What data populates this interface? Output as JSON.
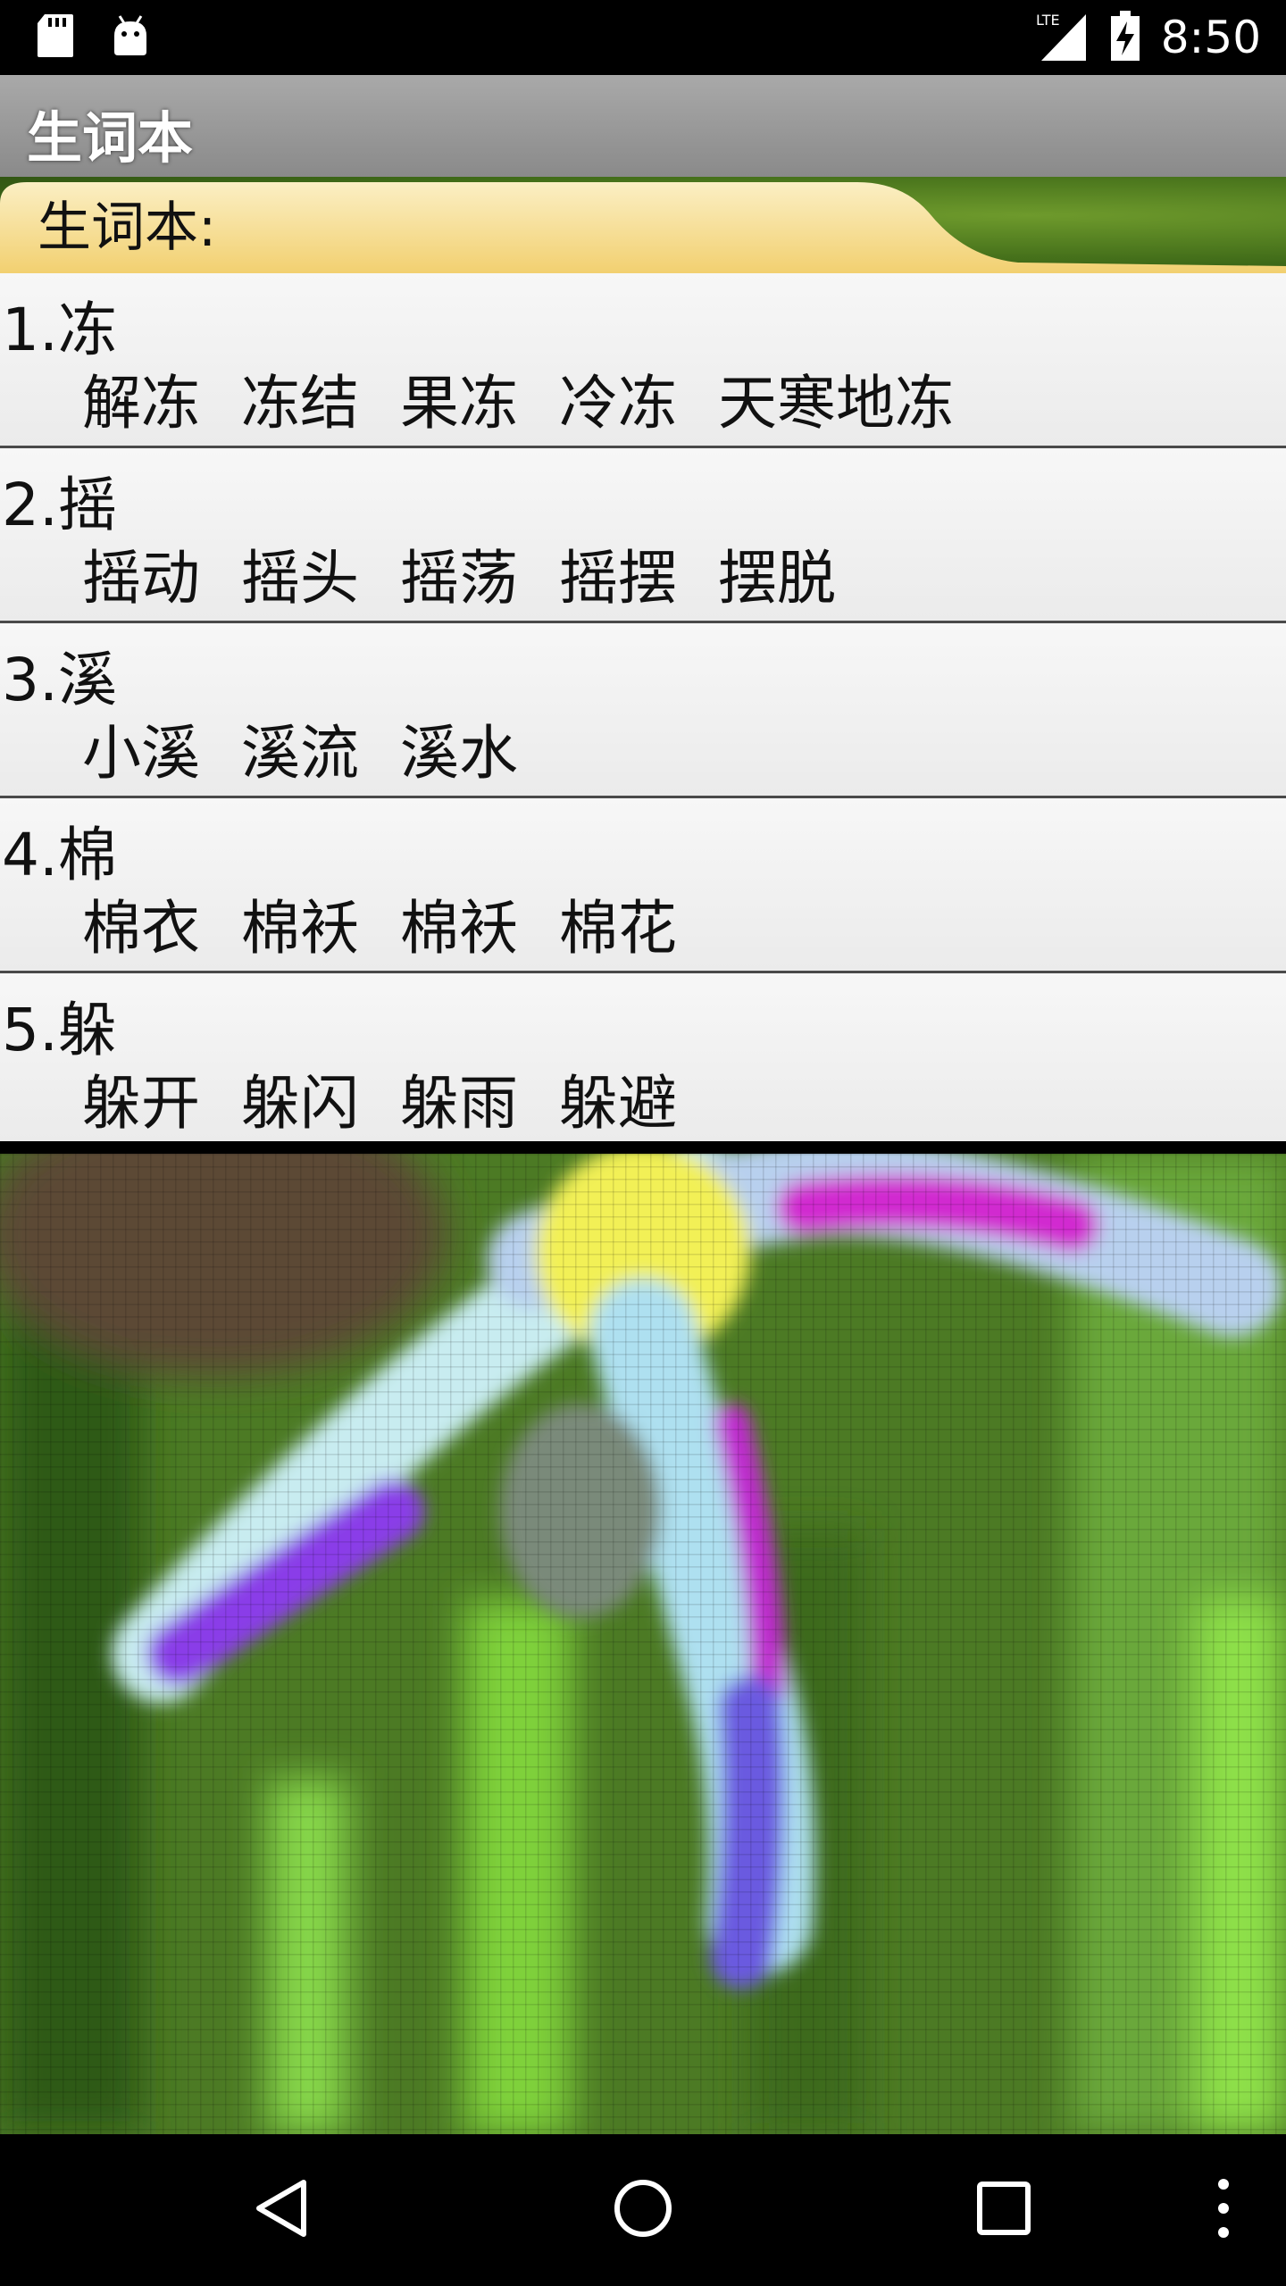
{
  "status_bar": {
    "time": "8:50",
    "network": "LTE",
    "icons": [
      "sd-card-icon",
      "android-icon",
      "signal-icon",
      "battery-charging-icon"
    ]
  },
  "app": {
    "title": "生词本"
  },
  "header": {
    "label": "生词本:"
  },
  "words": [
    {
      "head": "1.冻",
      "examples": [
        "解冻",
        "冻结",
        "果冻",
        "冷冻",
        "天寒地冻"
      ]
    },
    {
      "head": "2.摇",
      "examples": [
        "摇动",
        "摇头",
        "摇荡",
        "摇摆",
        "摆脱"
      ]
    },
    {
      "head": "3.溪",
      "examples": [
        "小溪",
        "溪流",
        "溪水"
      ]
    },
    {
      "head": "4.棉",
      "examples": [
        "棉衣",
        "棉袄",
        "棉袄",
        "棉花"
      ]
    },
    {
      "head": "5.躲",
      "examples": [
        "躲开",
        "躲闪",
        "躲雨",
        "躲避"
      ]
    }
  ],
  "nav_bar": {
    "icons": [
      "back-icon",
      "home-icon",
      "recents-icon",
      "overflow-menu-icon"
    ]
  },
  "colors": {
    "title_bar": "#999999",
    "header_tab": "#f7dc8c",
    "list_bg": "#f2f2f2",
    "divider": "#4a4a4a"
  }
}
